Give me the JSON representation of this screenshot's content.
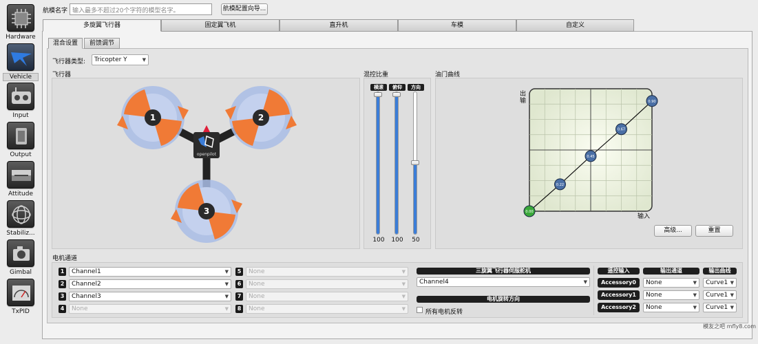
{
  "sidebar": {
    "items": [
      {
        "label": "Hardware",
        "icon": "hardware-icon"
      },
      {
        "label": "Vehicle",
        "icon": "vehicle-icon"
      },
      {
        "label": "Input",
        "icon": "input-icon"
      },
      {
        "label": "Output",
        "icon": "output-icon"
      },
      {
        "label": "Attitude",
        "icon": "attitude-icon"
      },
      {
        "label": "Stabiliz...",
        "icon": "stabilization-icon"
      },
      {
        "label": "Gimbal",
        "icon": "gimbal-icon"
      },
      {
        "label": "TxPID",
        "icon": "txpid-icon"
      }
    ],
    "active": "Vehicle"
  },
  "top": {
    "name_label": "航模名字",
    "name_placeholder": "输入最多不超过20个字符的模型名字。",
    "wizard_button": "航模配置向导..."
  },
  "tabs": [
    "多旋翼飞行器",
    "固定翼飞机",
    "直升机",
    "车模",
    "自定义"
  ],
  "active_tab": "多旋翼飞行器",
  "subtabs": [
    "混合设置",
    "前馈调节"
  ],
  "active_subtab": "混合设置",
  "frame": {
    "type_label": "飞行器类型:",
    "type_value": "Tricopter Y",
    "aircraft_label": "飞行器",
    "logo_text": "openpilot",
    "motors": [
      "1",
      "2",
      "3"
    ]
  },
  "mix": {
    "title": "混控比重",
    "sliders": [
      {
        "label": "横滚",
        "value": "100",
        "level": 1.0
      },
      {
        "label": "俯仰",
        "value": "100",
        "level": 1.0
      },
      {
        "label": "方向",
        "value": "50",
        "level": 0.5
      }
    ]
  },
  "throttle_curve": {
    "title": "油门曲线",
    "y_label": "出输",
    "x_label": "输入",
    "points": [
      {
        "x": 0,
        "y": 0,
        "label": "0.00"
      },
      {
        "x": 0.25,
        "y": 0.22,
        "label": "0.22"
      },
      {
        "x": 0.5,
        "y": 0.45,
        "label": "0.45"
      },
      {
        "x": 0.75,
        "y": 0.67,
        "label": "0.67"
      },
      {
        "x": 1,
        "y": 0.9,
        "label": "0.90"
      }
    ],
    "advanced_button": "高级...",
    "reset_button": "重置"
  },
  "motor_channels": {
    "title": "电机通道",
    "left": [
      {
        "num": "1",
        "value": "Channel1",
        "enabled": true
      },
      {
        "num": "2",
        "value": "Channel2",
        "enabled": true
      },
      {
        "num": "3",
        "value": "Channel3",
        "enabled": true
      },
      {
        "num": "4",
        "value": "None",
        "enabled": false
      }
    ],
    "right": [
      {
        "num": "5",
        "value": "None"
      },
      {
        "num": "6",
        "value": "None"
      },
      {
        "num": "7",
        "value": "None"
      },
      {
        "num": "8",
        "value": "None"
      }
    ]
  },
  "servo": {
    "title": "三旋翼飞行器伺服舵机",
    "value": "Channel4",
    "direction_title": "电机旋转方向",
    "reverse_label": "所有电机反转"
  },
  "accessory": {
    "headers": [
      "遥控输入",
      "输出通道",
      "输出曲线"
    ],
    "rows": [
      {
        "input": "Accessory0",
        "channel": "None",
        "curve": "Curve1"
      },
      {
        "input": "Accessory1",
        "channel": "None",
        "curve": "Curve1"
      },
      {
        "input": "Accessory2",
        "channel": "None",
        "curve": "Curve1"
      }
    ]
  },
  "watermark": "模友之吧 mfly8.com",
  "colors": {
    "accent": "#3b7dd8",
    "rotor": "#f07a36",
    "halo": "#a9bde6",
    "green": "#3aa83a"
  }
}
